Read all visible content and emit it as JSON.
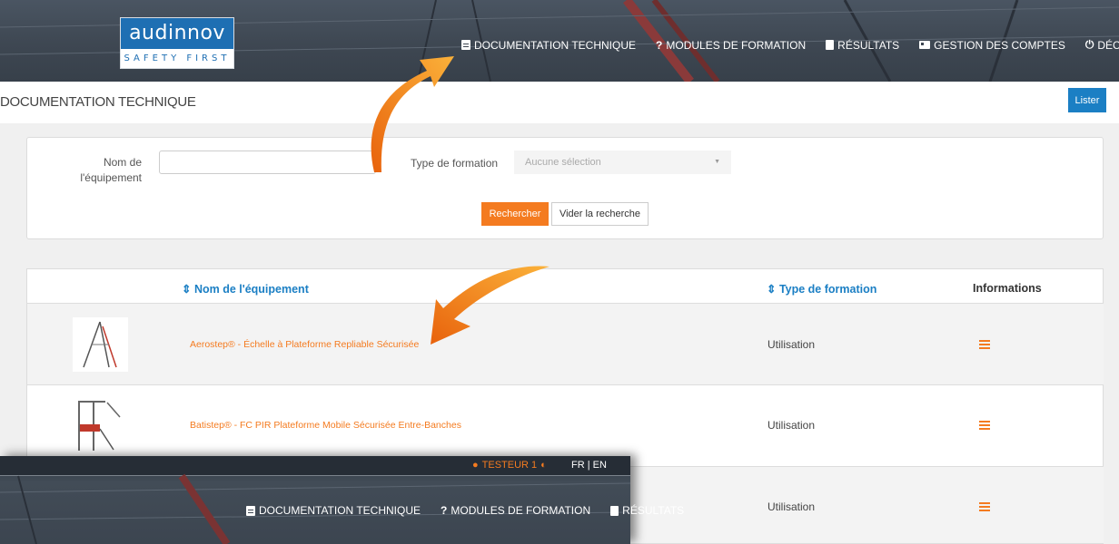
{
  "brand": {
    "name": "audinnov",
    "tagline": "SAFETY FIRST"
  },
  "nav": [
    {
      "label": "DOCUMENTATION TECHNIQUE",
      "icon": "document-icon"
    },
    {
      "label": "MODULES DE FORMATION",
      "icon": "question-icon"
    },
    {
      "label": "RÉSULTATS",
      "icon": "clipboard-icon"
    },
    {
      "label": "GESTION DES COMPTES",
      "icon": "id-card-icon"
    },
    {
      "label": "DÉCONNEXIO",
      "icon": "power-icon"
    }
  ],
  "page": {
    "title": "DOCUMENTATION TECHNIQUE",
    "list_button": "Lister"
  },
  "search": {
    "name_label": "Nom de l'équipement",
    "name_value": "",
    "type_label": "Type de formation",
    "type_selected": "Aucune sélection",
    "search_button": "Rechercher",
    "clear_button": "Vider la recherche"
  },
  "table": {
    "columns": [
      "Nom de l'équipement",
      "Type de formation",
      "Informations"
    ],
    "rows": [
      {
        "name": "Aerostep® - Échelle à Plateforme Repliable Sécurisée",
        "type": "Utilisation"
      },
      {
        "name": "Batistep® - FC PIR Plateforme Mobile Sécurisée Entre-Banches",
        "type": "Utilisation"
      },
      {
        "name": "",
        "type": "Utilisation"
      }
    ]
  },
  "overlay": {
    "user": "TESTEUR 1",
    "lang": "FR | EN",
    "nav": [
      {
        "label": "DOCUMENTATION TECHNIQUE",
        "icon": "document-icon"
      },
      {
        "label": "MODULES DE FORMATION",
        "icon": "question-icon"
      },
      {
        "label": "RÉSULTATS",
        "icon": "clipboard-icon"
      }
    ]
  },
  "colors": {
    "accent": "#f47b20",
    "primary": "#1b7fc4",
    "header": "#3e4752"
  }
}
